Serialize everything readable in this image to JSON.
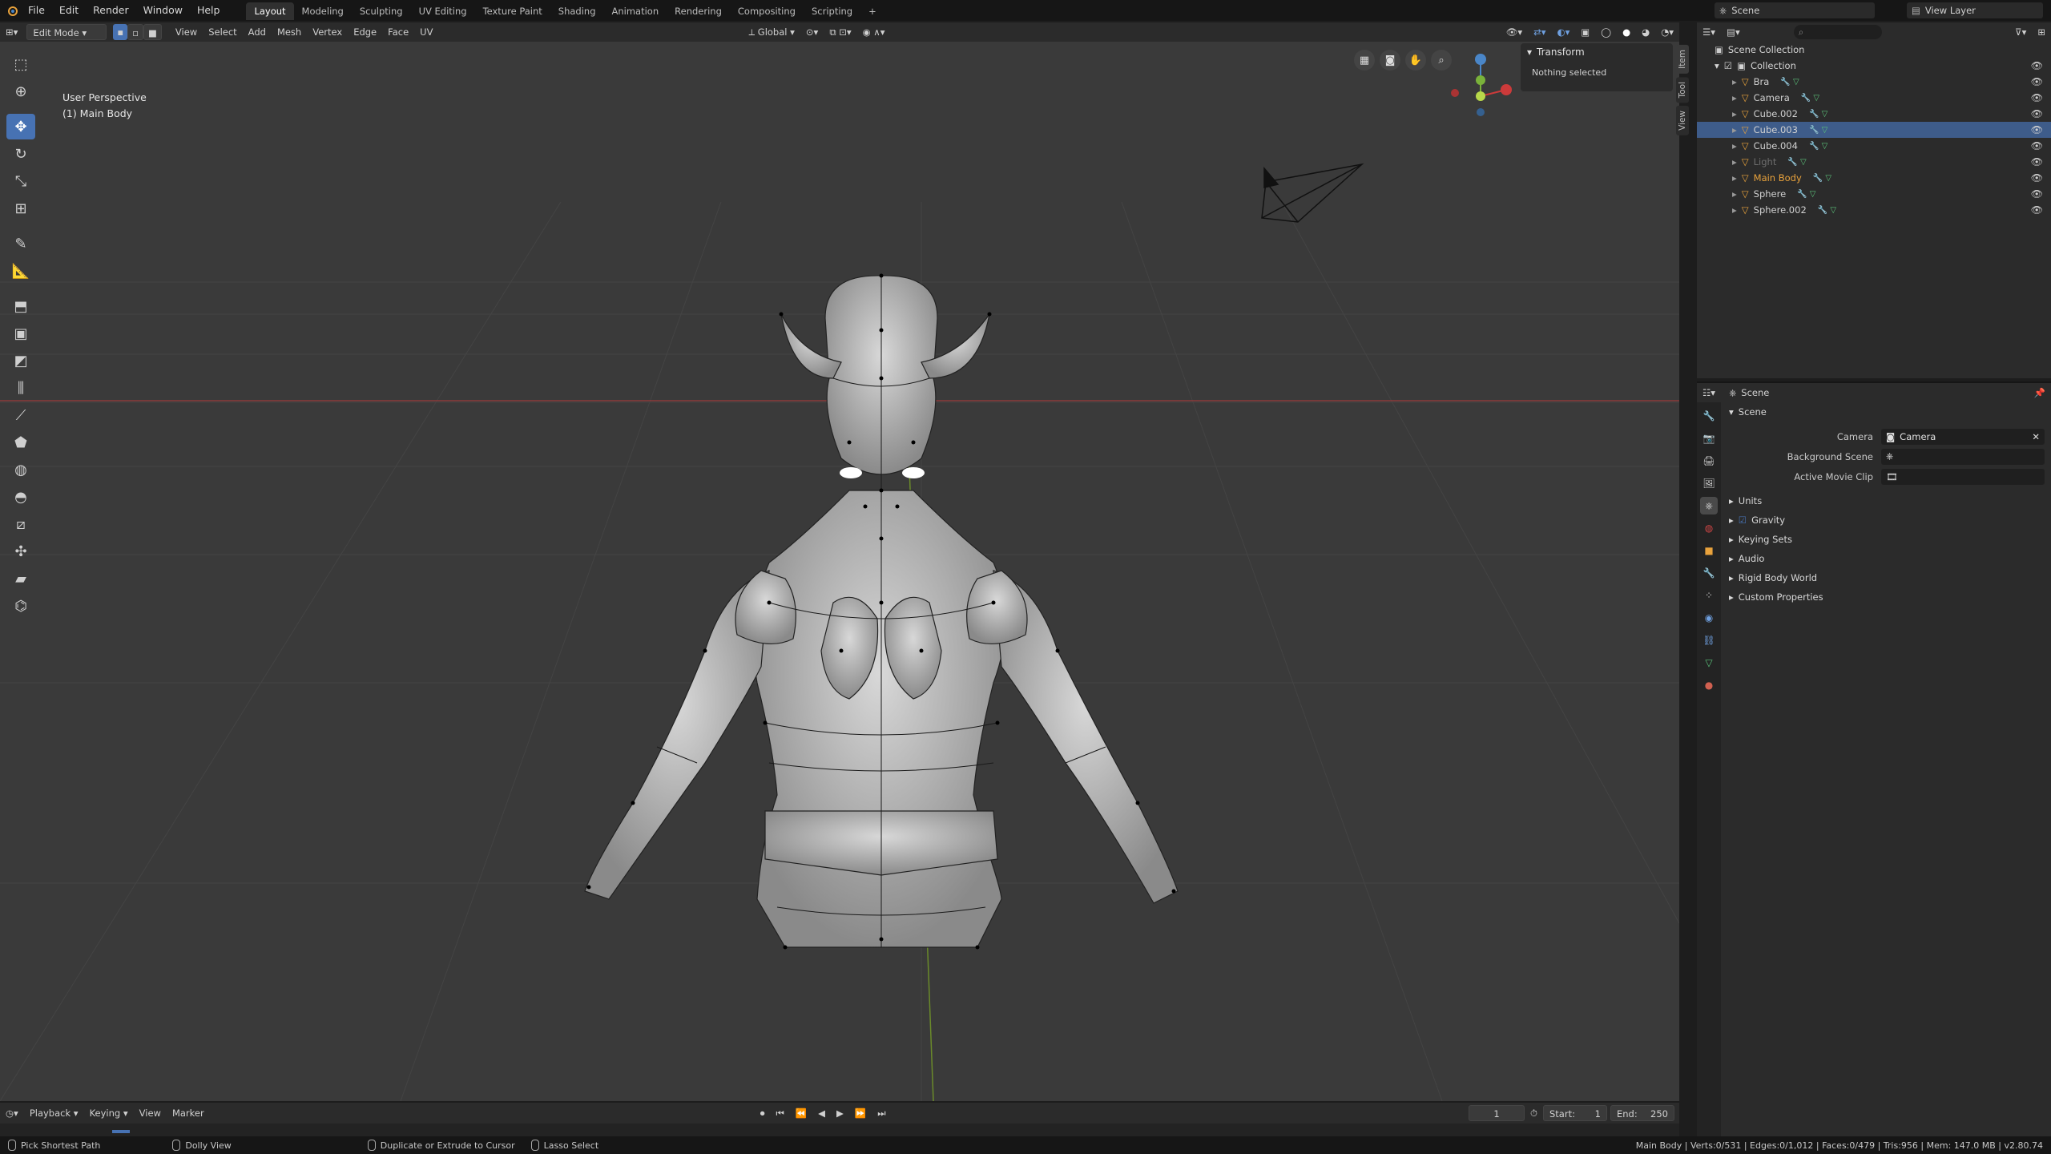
{
  "topbar": {
    "menus": [
      "File",
      "Edit",
      "Render",
      "Window",
      "Help"
    ],
    "workspaces": [
      "Layout",
      "Modeling",
      "Sculpting",
      "UV Editing",
      "Texture Paint",
      "Shading",
      "Animation",
      "Rendering",
      "Compositing",
      "Scripting"
    ],
    "active_workspace": "Layout",
    "add_tab": "+",
    "scene": "Scene",
    "view_layer": "View Layer"
  },
  "header3d": {
    "mode": "Edit Mode",
    "menus": [
      "View",
      "Select",
      "Add",
      "Mesh",
      "Vertex",
      "Edge",
      "Face",
      "UV"
    ],
    "orientation": "Global"
  },
  "viewport": {
    "perspective": "User Perspective",
    "object": "(1) Main Body"
  },
  "npanel": {
    "section": "Transform",
    "message": "Nothing selected",
    "tabs": [
      "Item",
      "Tool",
      "View"
    ]
  },
  "outliner": {
    "root": "Scene Collection",
    "collection": "Collection",
    "items": [
      {
        "name": "Bra",
        "selected": false,
        "color": "#d0d0d0"
      },
      {
        "name": "Camera",
        "selected": false,
        "color": "#d0d0d0"
      },
      {
        "name": "Cube.002",
        "selected": false,
        "color": "#d0d0d0"
      },
      {
        "name": "Cube.003",
        "selected": true,
        "color": "#d0d0d0"
      },
      {
        "name": "Cube.004",
        "selected": false,
        "color": "#d0d0d0"
      },
      {
        "name": "Light",
        "selected": false,
        "color": "#6e6e6e"
      },
      {
        "name": "Main Body",
        "selected": false,
        "color": "#e8a23c"
      },
      {
        "name": "Sphere",
        "selected": false,
        "color": "#d0d0d0"
      },
      {
        "name": "Sphere.002",
        "selected": false,
        "color": "#d0d0d0"
      }
    ]
  },
  "properties": {
    "header": "Scene",
    "section": "Scene",
    "camera_label": "Camera",
    "camera_value": "Camera",
    "bg_label": "Background Scene",
    "clip_label": "Active Movie Clip",
    "subsections": [
      "Units",
      "Gravity",
      "Keying Sets",
      "Audio",
      "Rigid Body World",
      "Custom Properties"
    ]
  },
  "timeline": {
    "menus": [
      "Playback",
      "Keying",
      "View",
      "Marker"
    ],
    "current_frame": "1",
    "start_label": "Start:",
    "start": "1",
    "end_label": "End:",
    "end": "250"
  },
  "statusbar": {
    "left1": "Pick Shortest Path",
    "left2": "Dolly View",
    "left3": "Duplicate or Extrude to Cursor",
    "left4": "Lasso Select",
    "stats": "Main Body | Verts:0/531 | Edges:0/1,012 | Faces:0/479 | Tris:956 | Mem: 147.0 MB | v2.80.74"
  },
  "colors": {
    "accent": "#4772b3",
    "selected_row": "#3e5c8a",
    "active_object": "#e8a23c"
  }
}
